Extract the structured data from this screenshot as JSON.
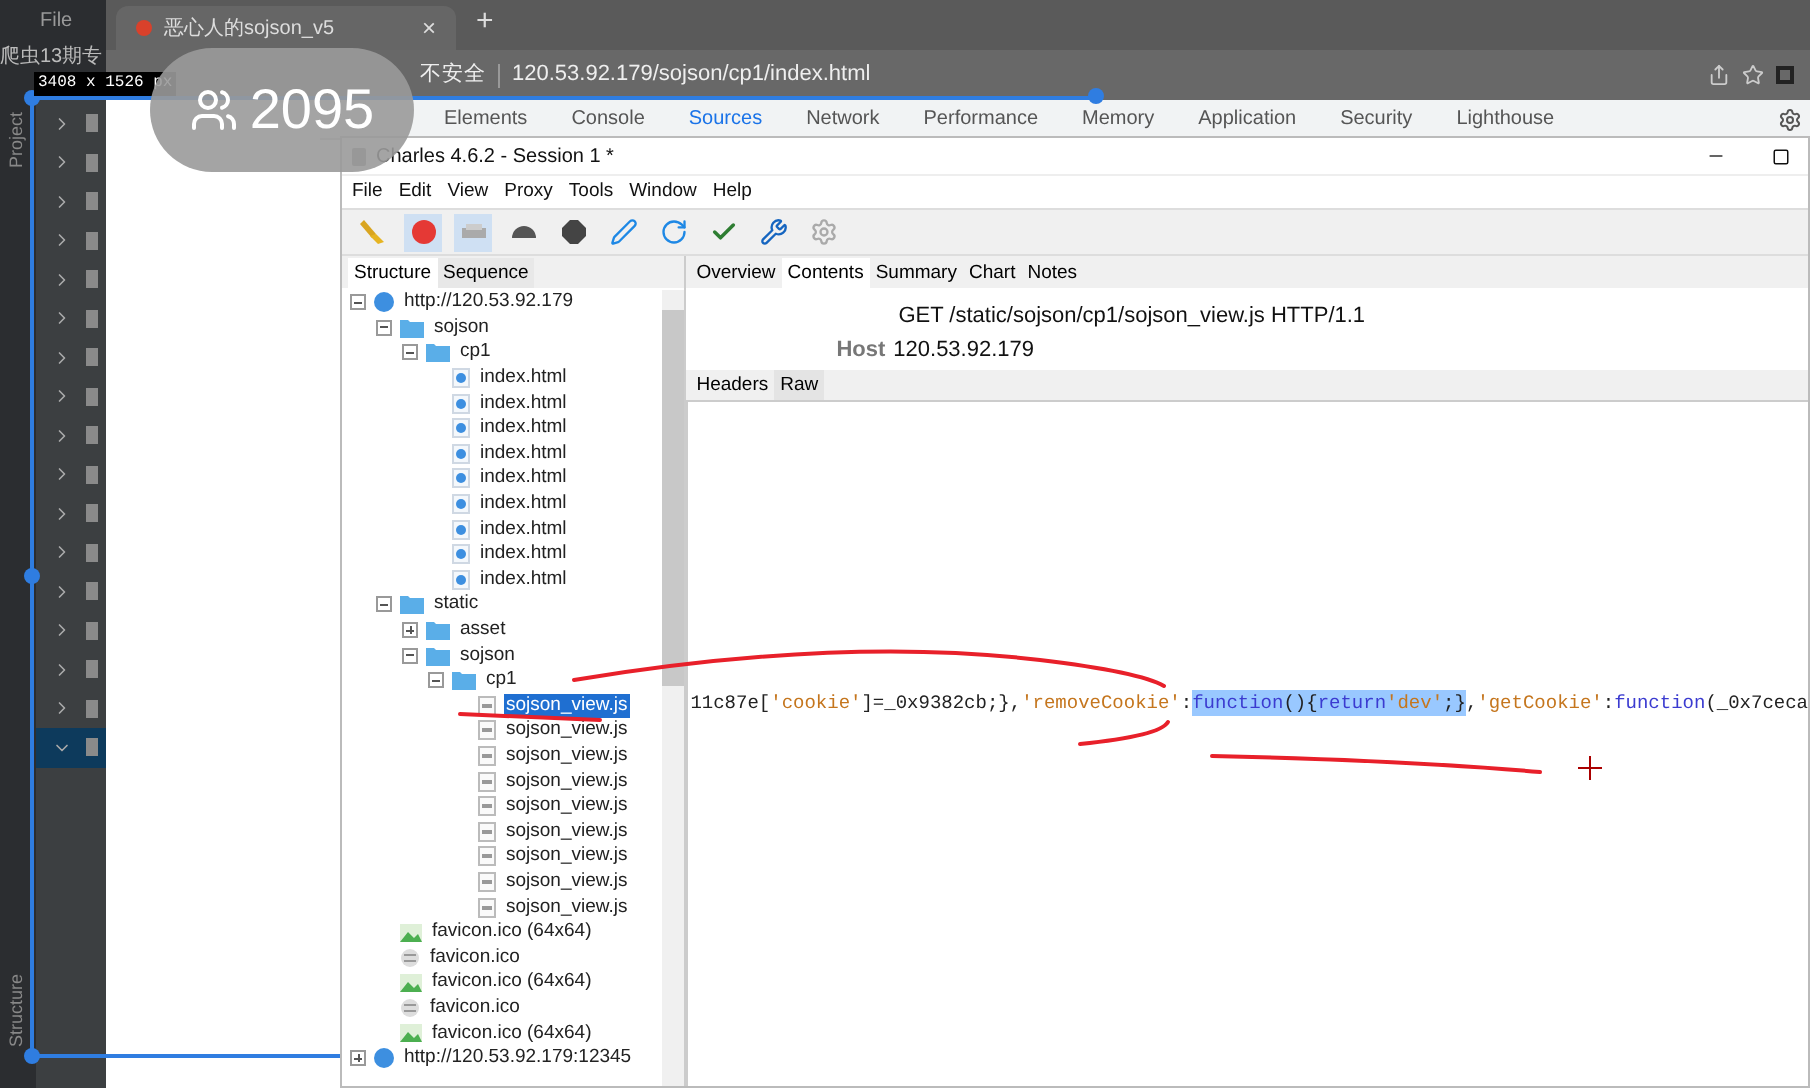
{
  "ide": {
    "menu": "File",
    "project_label": "爬虫13期专",
    "side_tabs": [
      "Project",
      "Structure"
    ],
    "rows": [
      {
        "expanded": false,
        "selected": false
      },
      {
        "expanded": false,
        "selected": false
      },
      {
        "expanded": false,
        "selected": false
      },
      {
        "expanded": false,
        "selected": false
      },
      {
        "expanded": false,
        "selected": false
      },
      {
        "expanded": false,
        "selected": false
      },
      {
        "expanded": false,
        "selected": false
      },
      {
        "expanded": false,
        "selected": false
      },
      {
        "expanded": false,
        "selected": false
      },
      {
        "expanded": false,
        "selected": false
      },
      {
        "expanded": false,
        "selected": false
      },
      {
        "expanded": false,
        "selected": false
      },
      {
        "expanded": false,
        "selected": false
      },
      {
        "expanded": false,
        "selected": false
      },
      {
        "expanded": false,
        "selected": false
      },
      {
        "expanded": false,
        "selected": false
      },
      {
        "expanded": true,
        "selected": true
      }
    ]
  },
  "browser": {
    "tab": {
      "title": "恶心人的sojson_v5",
      "close": "×"
    },
    "new_tab": "+",
    "security": "不安全",
    "url": "120.53.92.179/sojson/cp1/index.html"
  },
  "devtools": {
    "tabs": [
      {
        "label": "Elements",
        "selected": false
      },
      {
        "label": "Console",
        "selected": false
      },
      {
        "label": "Sources",
        "selected": true
      },
      {
        "label": "Network",
        "selected": false
      },
      {
        "label": "Performance",
        "selected": false
      },
      {
        "label": "Memory",
        "selected": false
      },
      {
        "label": "Application",
        "selected": false
      },
      {
        "label": "Security",
        "selected": false
      },
      {
        "label": "Lighthouse",
        "selected": false
      }
    ]
  },
  "overlay": {
    "viewers": "2095",
    "dimensions": "3408 x 1526 px"
  },
  "charles": {
    "title": "Charles 4.6.2 - Session 1 *",
    "menu": [
      "File",
      "Edit",
      "View",
      "Proxy",
      "Tools",
      "Window",
      "Help"
    ],
    "toolbar": [
      {
        "kind": "broom",
        "on": false
      },
      {
        "kind": "record",
        "on": true
      },
      {
        "kind": "throttle",
        "on": true
      },
      {
        "kind": "turtle",
        "on": false
      },
      {
        "kind": "stop",
        "on": false
      },
      {
        "kind": "pen",
        "on": false
      },
      {
        "kind": "refresh",
        "on": false
      },
      {
        "kind": "check",
        "on": false
      },
      {
        "kind": "tools",
        "on": false
      },
      {
        "kind": "settings",
        "on": false
      }
    ],
    "left_tabs": [
      {
        "label": "Structure",
        "selected": true
      },
      {
        "label": "Sequence",
        "selected": false
      }
    ],
    "tree": [
      {
        "label": "http://120.53.92.179",
        "kind": "host",
        "expanded": true,
        "selected": false,
        "children": [
          {
            "label": "sojson",
            "kind": "folder",
            "expanded": true,
            "selected": false,
            "children": [
              {
                "label": "cp1",
                "kind": "folder",
                "expanded": true,
                "selected": false,
                "children": [
                  {
                    "label": "index.html",
                    "kind": "html",
                    "selected": false
                  },
                  {
                    "label": "index.html",
                    "kind": "html",
                    "selected": false
                  },
                  {
                    "label": "index.html",
                    "kind": "html",
                    "selected": false
                  },
                  {
                    "label": "index.html",
                    "kind": "html",
                    "selected": false
                  },
                  {
                    "label": "index.html",
                    "kind": "html",
                    "selected": false
                  },
                  {
                    "label": "index.html",
                    "kind": "html",
                    "selected": false
                  },
                  {
                    "label": "index.html",
                    "kind": "html",
                    "selected": false
                  },
                  {
                    "label": "index.html",
                    "kind": "html",
                    "selected": false
                  },
                  {
                    "label": "index.html",
                    "kind": "html",
                    "selected": false
                  }
                ]
              }
            ]
          },
          {
            "label": "static",
            "kind": "folder",
            "expanded": true,
            "selected": false,
            "children": [
              {
                "label": "asset",
                "kind": "folder",
                "expanded": false,
                "selected": false
              },
              {
                "label": "sojson",
                "kind": "folder",
                "expanded": true,
                "selected": false,
                "children": [
                  {
                    "label": "cp1",
                    "kind": "folder",
                    "expanded": true,
                    "selected": false,
                    "children": [
                      {
                        "label": "sojson_view.js",
                        "kind": "js",
                        "selected": true
                      },
                      {
                        "label": "sojson_view.js",
                        "kind": "js",
                        "selected": false
                      },
                      {
                        "label": "sojson_view.js",
                        "kind": "js",
                        "selected": false
                      },
                      {
                        "label": "sojson_view.js",
                        "kind": "js",
                        "selected": false
                      },
                      {
                        "label": "sojson_view.js",
                        "kind": "js",
                        "selected": false
                      },
                      {
                        "label": "sojson_view.js",
                        "kind": "js",
                        "selected": false
                      },
                      {
                        "label": "sojson_view.js",
                        "kind": "js",
                        "selected": false
                      },
                      {
                        "label": "sojson_view.js",
                        "kind": "js",
                        "selected": false
                      },
                      {
                        "label": "sojson_view.js",
                        "kind": "js",
                        "selected": false
                      }
                    ]
                  }
                ]
              }
            ]
          },
          {
            "label": "favicon.ico (64x64)",
            "kind": "image",
            "selected": false
          },
          {
            "label": "favicon.ico",
            "kind": "other",
            "selected": false
          },
          {
            "label": "favicon.ico (64x64)",
            "kind": "image",
            "selected": false
          },
          {
            "label": "favicon.ico",
            "kind": "other",
            "selected": false
          },
          {
            "label": "favicon.ico (64x64)",
            "kind": "image",
            "selected": false
          }
        ]
      },
      {
        "label": "http://120.53.92.179:12345",
        "kind": "host",
        "expanded": false,
        "selected": false
      }
    ],
    "right_tabs": [
      {
        "label": "Overview",
        "selected": false
      },
      {
        "label": "Contents",
        "selected": true
      },
      {
        "label": "Summary",
        "selected": false
      },
      {
        "label": "Chart",
        "selected": false
      },
      {
        "label": "Notes",
        "selected": false
      }
    ],
    "request_line": "GET /static/sojson/cp1/sojson_view.js HTTP/1.1",
    "host_label": "Host",
    "host_value": "120.53.92.179",
    "sub_tabs": [
      {
        "label": "Headers",
        "selected": false
      },
      {
        "label": "Raw",
        "selected": true
      }
    ],
    "code": [
      {
        "text": "11c87e[",
        "kind": "plain",
        "selected": false
      },
      {
        "text": "'cookie'",
        "kind": "string",
        "selected": false
      },
      {
        "text": "]=_0x9382cb;},",
        "kind": "plain",
        "selected": false
      },
      {
        "text": "'removeCookie'",
        "kind": "string",
        "selected": false
      },
      {
        "text": ":",
        "kind": "plain",
        "selected": false
      },
      {
        "text": "function",
        "kind": "keyword",
        "selected": true
      },
      {
        "text": "(){",
        "kind": "plain",
        "selected": true
      },
      {
        "text": "return",
        "kind": "keyword",
        "selected": true
      },
      {
        "text": "'dev'",
        "kind": "string",
        "selected": true
      },
      {
        "text": ";}",
        "kind": "plain",
        "selected": true
      },
      {
        "text": ",",
        "kind": "plain",
        "selected": false
      },
      {
        "text": "'getCookie'",
        "kind": "string",
        "selected": false
      },
      {
        "text": ":",
        "kind": "plain",
        "selected": false
      },
      {
        "text": "function",
        "kind": "keyword",
        "selected": false
      },
      {
        "text": "(_0x7ceca",
        "kind": "plain",
        "selected": false
      }
    ]
  }
}
